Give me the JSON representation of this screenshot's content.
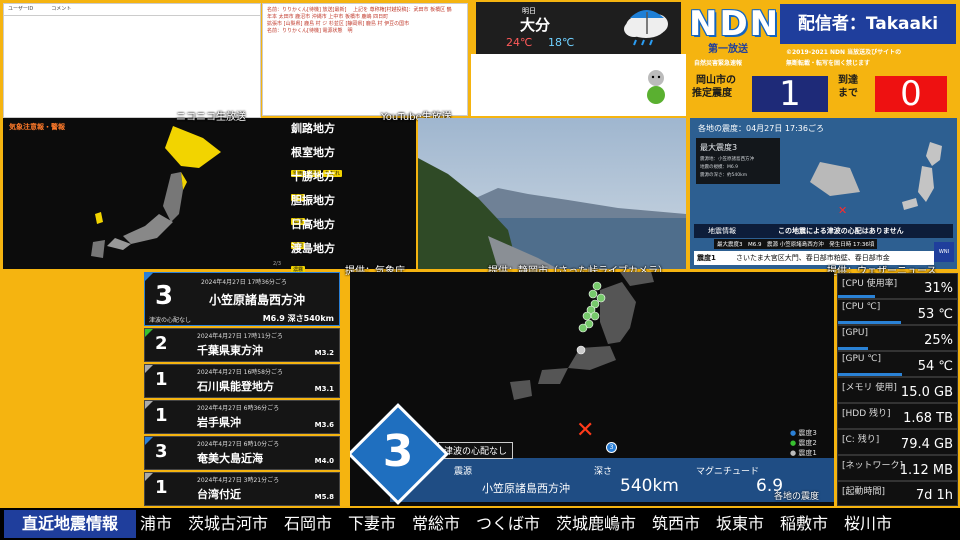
{
  "comments": {
    "header_user": "ユーザーID",
    "header_comment": "コメント",
    "lines": [
      "名前：りりかくん[待機] 放送[最新]　 上記を 尊称権[村越投稿]：武田市 板橋区 鶴",
      "年本 太田市 鹿沼市 沖縄市 上中市 板橋市 鹿嶋 四日町",
      "拡張市 [山梨県] 鹿島 村 ジ 杉並区 [静岡県] 鹿島 村 伊豆の国市",
      "名前：りりかくん[待機] 電源状態　明"
    ]
  },
  "weather": {
    "label": "明日",
    "city": "大分",
    "high": "24℃",
    "low": "18℃"
  },
  "branding": {
    "logo": "NDN",
    "caster": "配信者：Takaaki",
    "broadcast": "第一放送",
    "broadcast_sub": "自然災害緊急速報",
    "copyright": "©2019-2021 NDN 当放送及びサイトの",
    "copyright2": "無断転載・転写を固く禁じます",
    "site_label": "岡山市の",
    "site_label2": "推定震度",
    "estimated_intensity": "1",
    "arrival_label": "到達",
    "arrival_label2": "まで",
    "arrival_seconds": "0"
  },
  "overlays": {
    "niconico": "ニコニコ生放送",
    "youtube": "YouTube生放送",
    "jma": "提供：気象庁",
    "camera": "提供：静岡市（さった峠ライブカメラ）",
    "weathernews": "提供：ウェザーニュース",
    "shindo_label": "各地の震度"
  },
  "warnings": {
    "title": "気象注意報・警報",
    "page": "2/3",
    "regions": [
      {
        "name": "釧路地方",
        "chips": []
      },
      {
        "name": "根室地方",
        "chips": [
          "雷雨",
          "濃霧",
          "なだれ"
        ]
      },
      {
        "name": "十勝地方",
        "chips": [
          "濃霧"
        ]
      },
      {
        "name": "胆振地方",
        "chips": [
          "濃霧"
        ]
      },
      {
        "name": "日高地方",
        "chips": [
          "濃霧"
        ]
      },
      {
        "name": "渡島地方",
        "chips": [
          "濃霧"
        ]
      }
    ]
  },
  "wni": {
    "title": "各地の震度：04月27日 17:36ごろ",
    "max_label": "最大震度3",
    "epicenter": "震源地：小笠原諸島西方沖",
    "magnitude": "地震の規模：M6.9",
    "depth": "震源の深さ：約540km",
    "banner_label": "地震情報",
    "banner_text": "この地震による津波の心配はありません",
    "row2": "最大震度3　M6.9　震源 小笠原諸島西方沖　発生日時 17:36頃",
    "ticker_prefix": "震度1",
    "ticker_text": "さいたま大宮区大門、春日部市粕壁、春日部市金"
  },
  "quakes": [
    {
      "intensity": "3",
      "datetime": "2024年4月27日 17時36分ごろ",
      "location": "小笠原諸島西方沖",
      "tsunami": "津波の心配なし",
      "magnitude": "M6.9 深さ540km"
    },
    {
      "intensity": "2",
      "datetime": "2024年4月27日 17時11分ごろ",
      "location": "千葉県東方沖",
      "magnitude": "M3.2"
    },
    {
      "intensity": "1",
      "datetime": "2024年4月27日 16時58分ごろ",
      "location": "石川県能登地方",
      "magnitude": "M3.1"
    },
    {
      "intensity": "1",
      "datetime": "2024年4月27日 6時36分ごろ",
      "location": "岩手県沖",
      "magnitude": "M3.6"
    },
    {
      "intensity": "3",
      "datetime": "2024年4月27日 6時10分ごろ",
      "location": "奄美大島近海",
      "magnitude": "M4.0"
    },
    {
      "intensity": "1",
      "datetime": "2024年4月27日 3時21分ごろ",
      "location": "台湾付近",
      "magnitude": "M5.8"
    }
  ],
  "map": {
    "tsunami": "津波の心配なし",
    "intensity": "3",
    "epicenter_label": "震源",
    "epicenter": "小笠原諸島西方沖",
    "depth_label": "深さ",
    "depth": "540km",
    "magnitude_label": "マグニチュード",
    "magnitude": "6.9",
    "legend": [
      "震度3",
      "震度2",
      "震度1"
    ]
  },
  "stats": [
    {
      "label": "[CPU 使用率]",
      "value": "31%"
    },
    {
      "label": "[CPU ℃]",
      "value": "53 ℃"
    },
    {
      "label": "[GPU]",
      "value": "25%"
    },
    {
      "label": "[GPU ℃]",
      "value": "54 ℃"
    },
    {
      "label": "[メモリ 使用]",
      "value": "15.0 GB"
    },
    {
      "label": "[HDD 残り]",
      "value": "1.68 TB"
    },
    {
      "label": "[C: 残り]",
      "value": "79.4 GB"
    },
    {
      "label": "[ネットワーク]",
      "value": "1.12 MB"
    },
    {
      "label": "[起動時間]",
      "value": "7d 1h"
    }
  ],
  "ticker": {
    "label": "直近地震情報",
    "text": "浦市　茨城古河市　石岡市　下妻市　常総市　つくば市　茨城鹿嶋市　筑西市　坂東市　稲敷市　桜川市"
  },
  "colors": {
    "background": "#f5b410",
    "navy": "#1f3e9c",
    "warning_yellow": "#f2d400",
    "alert_red": "#ee1111"
  }
}
